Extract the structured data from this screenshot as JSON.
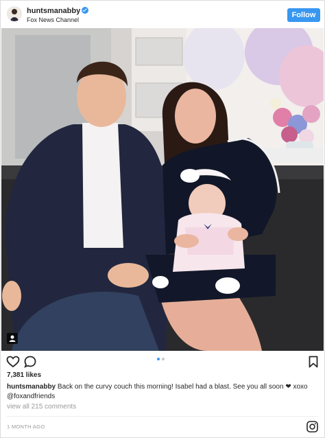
{
  "header": {
    "username": "huntsmanabby",
    "location": "Fox News Channel",
    "follow_label": "Follow",
    "verified_icon": "verified-badge-icon",
    "accent": "#3897f0"
  },
  "photo": {
    "description_icon": "tag-person-icon",
    "carousel_active_index": 0,
    "carousel_count": 2
  },
  "actions": {
    "icons": [
      "heart-icon",
      "comment-icon",
      "bookmark-icon"
    ]
  },
  "likes": "7,381 likes",
  "caption": {
    "username": "huntsmanabby",
    "text": "Back on the curvy couch this morning! Isabel had a blast. See you all soon ❤ xoxo",
    "mention": "@foxandfriends"
  },
  "comments_link": "view all 215 comments",
  "timestamp": "1 MONTH AGO",
  "footer_icon": "instagram-glyph-icon"
}
